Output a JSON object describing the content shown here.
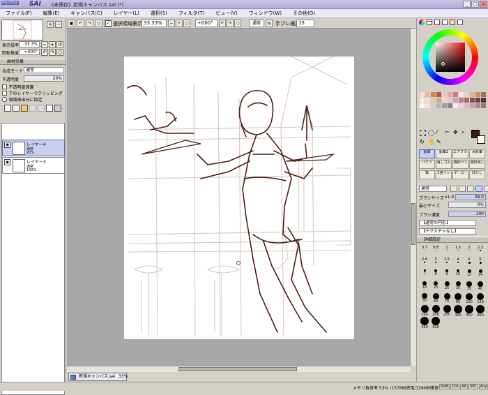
{
  "app": {
    "logo_small": "PaintTool",
    "logo_big": "SAI",
    "title": "《未保存》新規キャンバス.sai (*)",
    "window_controls": [
      "_",
      "□",
      "×"
    ]
  },
  "menu": [
    "ファイル(F)",
    "編集(E)",
    "キャンバス(C)",
    "レイヤー(L)",
    "選択(S)",
    "フィルタ(T)",
    "ビュー(V)",
    "ウィンドウ(W)",
    "その他(O)"
  ],
  "navigator": {
    "zoom_label": "表示倍率",
    "zoom_value": "33.3%",
    "angle_label": "回転角度",
    "angle_value": "+000°"
  },
  "layer_props": {
    "section_title": "画材効果",
    "blend_label": "合成モード",
    "blend_value": "通常",
    "opacity_label": "不透明度",
    "opacity_value": "20%",
    "options": [
      "不透明度保護",
      "下のレイヤーでクリッピング",
      "領域検出元に指定"
    ]
  },
  "layers": [
    {
      "name": "レイヤー4",
      "mode": "通常",
      "opacity": "20%",
      "selected": true
    },
    {
      "name": "レイヤー3",
      "mode": "通常",
      "opacity": "100%",
      "selected": false
    }
  ],
  "toolbar": {
    "selection_checkbox_label": "選択領域表示",
    "zoom": "33.33%",
    "rotation": "+000°",
    "mode": "通常",
    "stabilizer_label": "手ブレ補正",
    "stabilizer_value": "13"
  },
  "document_tab": {
    "name": "新規キャンバス.sai",
    "zoom": "33%"
  },
  "color_swatches": [
    "#f6dccf",
    "#e8b8a0",
    "#d08868",
    "#b85840",
    "#f0c8c0",
    "#e0a8a0",
    "#c88080",
    "#f8e8e0",
    "#e8d0c0",
    "#d8b898",
    "#c09070",
    "#a07050",
    "#f8f0e8",
    "#f0e0d0",
    "#e0c8b0",
    "#c8a888",
    "#f0d8d8",
    "#e8c0c8",
    "#d0a0a8",
    "#b88088",
    "#a06870",
    "#885058",
    "#704048",
    "#583038",
    "#f8f8f8",
    "#e8e8e8",
    "#d0d0d0",
    "#b8b8b8",
    "#a0a0a0",
    "#888888",
    "#f8e8f0",
    "#f0d0e0",
    "#e0b8c8",
    "#c8a0b0",
    "#b08898",
    "#987080"
  ],
  "current_colors": {
    "primary": "#3a1a14",
    "secondary": "#ffffff"
  },
  "tools": [
    {
      "label": "鉛筆",
      "selected": true
    },
    {
      "label": "鉛筆2",
      "selected": false
    },
    {
      "label": "エアブラシ",
      "selected": false
    },
    {
      "label": "水彩筆",
      "selected": false
    },
    {
      "label": "バケツ",
      "selected": false
    },
    {
      "label": "消しゴム",
      "selected": false
    },
    {
      "label": "選択ペン",
      "selected": false
    },
    {
      "label": "選択消し",
      "selected": false
    },
    {
      "label": "筆",
      "selected": false
    },
    {
      "label": "2値ペン",
      "selected": false
    },
    {
      "label": "マーカー",
      "selected": false
    },
    {
      "label": "ぼかし",
      "selected": false
    }
  ],
  "brush": {
    "mode": "通常",
    "size_label": "ブラシサイズ",
    "size_mult": "x1.0",
    "size_value": "28.0",
    "min_label": "最小サイズ",
    "min_value": "0%",
    "density_label": "ブラシ濃度",
    "density_value": "100",
    "shape": "【通常の円形】",
    "texture": "【テクスチャなし】",
    "detail_label": "詳細設定",
    "sizes": [
      "0.7",
      "0.8",
      "1",
      "1.5",
      "2",
      "2.3",
      "2.6",
      "3",
      "3.5",
      "4",
      "5",
      "6",
      "7",
      "8",
      "9",
      "10",
      "12",
      "14",
      "16",
      "20",
      "25",
      "30",
      "35",
      "40",
      "50",
      "60",
      "70",
      "80",
      "100",
      "120",
      "160",
      "200",
      "250",
      "300",
      "350",
      "400",
      "450",
      "500"
    ]
  },
  "status": {
    "memory": "メモリ負荷率 53% (157MB使用/729MB確保)",
    "keys": [
      "Shift",
      "Ctrl",
      "Alt",
      "SPC",
      "Any"
    ]
  }
}
